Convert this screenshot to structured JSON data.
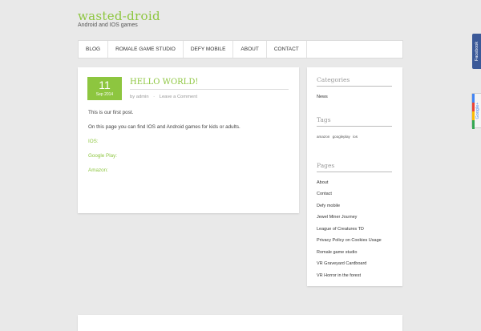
{
  "site": {
    "title": "wasted-droid",
    "tagline": "Android and IOS games"
  },
  "nav": {
    "items": [
      "BLOG",
      "ROMALE GAME STUDIO",
      "DEFY MOBILE",
      "ABOUT",
      "CONTACT"
    ]
  },
  "post": {
    "day": "11",
    "month_year": "Sep 2014",
    "title": "HELLO WORLD!",
    "author_prefix": "by",
    "author": "admin",
    "separator": "·",
    "comment_link": "Leave a Comment",
    "paragraphs": [
      "This is our first post.",
      "On this page you can find IOS and Android games for kids or adults."
    ],
    "links": [
      "IOS:",
      "Google Play:",
      "Amazon:"
    ]
  },
  "sidebar": {
    "categories_title": "Categories",
    "categories": [
      "News"
    ],
    "tags_title": "Tags",
    "tags": [
      "amazon",
      "googleplay",
      "ios"
    ],
    "pages_title": "Pages",
    "pages": [
      "About",
      "Contact",
      "Defy mobile",
      "Jewel Miner Journey",
      "League of Creatures TD",
      "Privacy Policy on Cookies Usage",
      "Romale game studio",
      "VR Graveyard Cardboard",
      "VR Horror in the forest"
    ]
  },
  "social": {
    "facebook_label": "Facebook",
    "google_label": "Google+"
  },
  "colors": {
    "accent": "#8dc63f",
    "facebook": "#3b5998",
    "background": "#e9e9e9"
  }
}
